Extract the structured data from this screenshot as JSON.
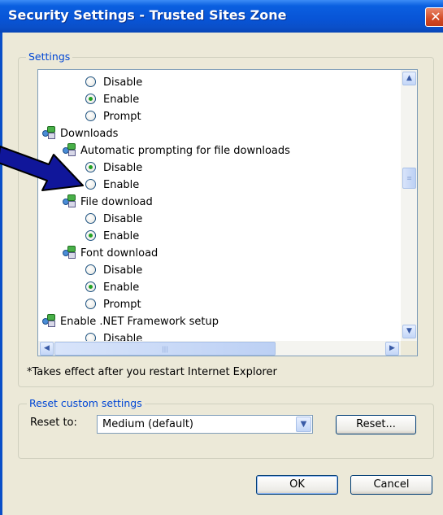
{
  "window": {
    "title": "Security Settings - Trusted Sites Zone",
    "close_glyph": "✕"
  },
  "settings_group": {
    "legend": "Settings",
    "tree": [
      {
        "type": "radio",
        "label": "Disable",
        "checked": false
      },
      {
        "type": "radio",
        "label": "Enable",
        "checked": true
      },
      {
        "type": "radio",
        "label": "Prompt",
        "checked": false
      },
      {
        "type": "category",
        "label": "Downloads",
        "icon": "settings-icon"
      },
      {
        "type": "setting",
        "label": "Automatic prompting for file downloads",
        "icon": "settings-icon"
      },
      {
        "type": "radio",
        "label": "Disable",
        "checked": true
      },
      {
        "type": "radio",
        "label": "Enable",
        "checked": false
      },
      {
        "type": "setting",
        "label": "File download",
        "icon": "settings-icon"
      },
      {
        "type": "radio",
        "label": "Disable",
        "checked": false
      },
      {
        "type": "radio",
        "label": "Enable",
        "checked": true
      },
      {
        "type": "setting",
        "label": "Font download",
        "icon": "settings-icon"
      },
      {
        "type": "radio",
        "label": "Disable",
        "checked": false
      },
      {
        "type": "radio",
        "label": "Enable",
        "checked": true
      },
      {
        "type": "radio",
        "label": "Prompt",
        "checked": false
      },
      {
        "type": "category",
        "label": "Enable .NET Framework setup",
        "icon": "settings-icon"
      },
      {
        "type": "radio",
        "label": "Disable",
        "checked": false
      }
    ],
    "restart_note": "*Takes effect after you restart Internet Explorer"
  },
  "reset_group": {
    "legend": "Reset custom settings",
    "reset_to_label": "Reset to:",
    "selected_level": "Medium (default)",
    "reset_button": "Reset..."
  },
  "footer": {
    "ok_button": "OK",
    "cancel_button": "Cancel"
  },
  "colors": {
    "title_bar": "#0854d6",
    "dialog_bg": "#ece9d8",
    "legend_text": "#0046d5",
    "annotation_arrow": "#10169a"
  }
}
